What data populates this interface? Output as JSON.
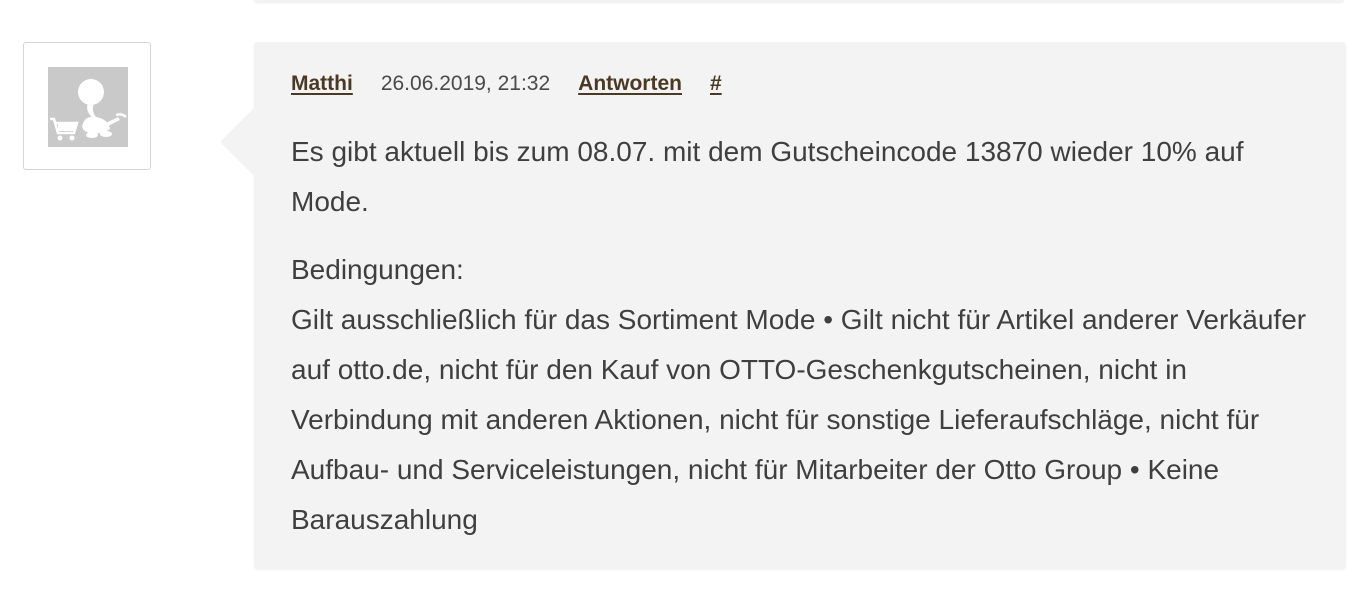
{
  "comment": {
    "author": "Matthi",
    "timestamp": "26.06.2019, 21:32",
    "reply_label": "Antworten",
    "permalink_label": "#",
    "paragraph1": "Es gibt aktuell bis zum 08.07. mit dem Gutscheincode 13870 wieder 10% auf Mode.",
    "conditions_heading": "Bedingungen:",
    "conditions_text": "Gilt ausschließlich für das Sortiment Mode • Gilt nicht für Artikel anderer Verkäufer auf otto.de, nicht für den Kauf von OTTO-Geschenkgutscheinen, nicht in Verbindung mit anderen Aktionen, nicht für sonstige Lieferaufschläge, nicht für Aufbau- und Serviceleistungen, nicht für Mitarbeiter der Otto Group • Keine Barauszahlung"
  },
  "avatar": {
    "icon": "default-avatar-shopping-cart-icon"
  },
  "colors": {
    "card_background": "#f3f3f3",
    "link": "#4a3a24",
    "text": "#3f3f3f",
    "avatar_bg": "#c9c9c9"
  }
}
